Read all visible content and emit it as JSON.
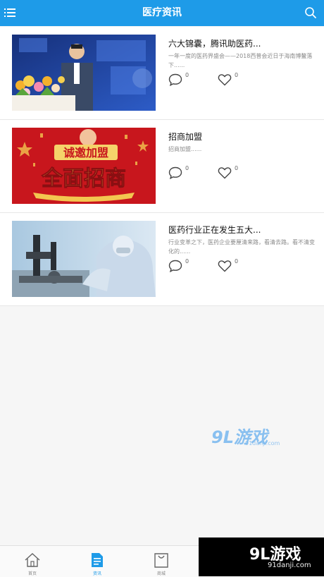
{
  "header": {
    "title": "医疗资讯"
  },
  "articles": [
    {
      "title": "六大锦囊，腾讯助医药...",
      "desc": "一年一度的医药界盛会——2018西普会近日于海南博鳌落下......",
      "comments": "0",
      "likes": "0",
      "image": "conference-speaker-photo"
    },
    {
      "title": "招商加盟",
      "desc": "招商加盟......",
      "comments": "0",
      "likes": "0",
      "image": "investment-banner",
      "banner": {
        "top": "诚邀加盟",
        "main": "全面招商"
      }
    },
    {
      "title": "医药行业正在发生五大...",
      "desc": "行业变革之下，医药企业要厘清来路，看清去路。看不清变化的......",
      "comments": "0",
      "likes": "0",
      "image": "lab-scientist-microscope-photo"
    }
  ],
  "watermark": {
    "logo": "9L游戏",
    "url": "91danji.com"
  },
  "tabbar": {
    "tabs": [
      {
        "label": "首页",
        "icon": "home-icon"
      },
      {
        "label": "资讯",
        "icon": "document-icon",
        "active": true
      },
      {
        "label": "商城",
        "icon": "shopping-bag-icon"
      }
    ]
  },
  "brand": {
    "logo": "9L游戏",
    "url": "91danji.com"
  },
  "colors": {
    "accent": "#1e9be8",
    "background": "#f6f6f6"
  }
}
